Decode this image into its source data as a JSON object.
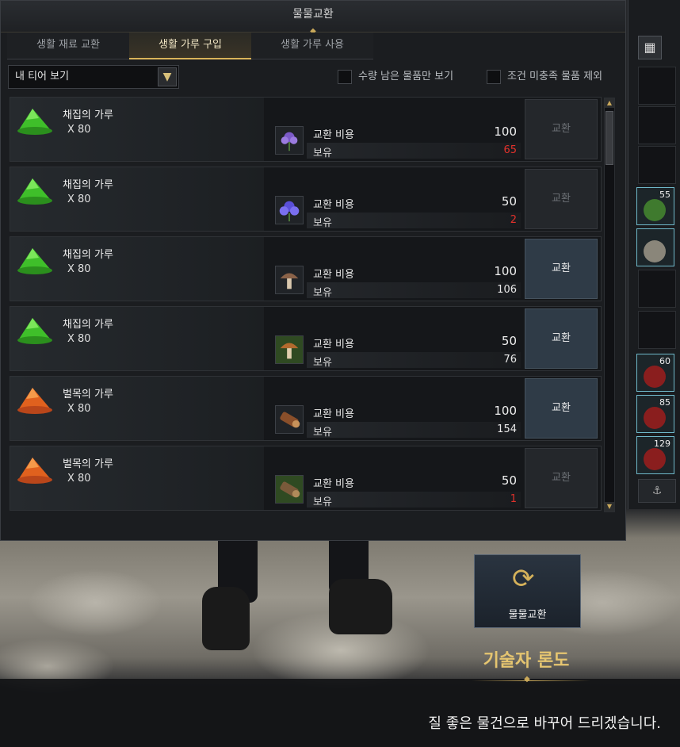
{
  "window": {
    "title": "물물교환"
  },
  "tabs": [
    {
      "label": "생활 재료 교환",
      "active": false
    },
    {
      "label": "생활 가루 구입",
      "active": true
    },
    {
      "label": "생활 가루 사용",
      "active": false
    }
  ],
  "filter": {
    "dropdown_value": "내 티어 보기",
    "checkbox_remaining": "수량 남은 물품만 보기",
    "checkbox_unmet": "조건 미충족 물품 제외"
  },
  "labels": {
    "cost": "교환 비용",
    "owned": "보유",
    "exchange": "교환"
  },
  "rows": [
    {
      "name": "채집의 가루",
      "qty": "X 80",
      "powder": "green",
      "cost_icon": "purple-flower-icon",
      "cost": "100",
      "owned": "65",
      "owned_low": true,
      "enabled": false
    },
    {
      "name": "채집의 가루",
      "qty": "X 80",
      "powder": "green",
      "cost_icon": "blue-flower-icon",
      "cost": "50",
      "owned": "2",
      "owned_low": true,
      "enabled": false
    },
    {
      "name": "채집의 가루",
      "qty": "X 80",
      "powder": "green",
      "cost_icon": "mushroom-icon",
      "cost": "100",
      "owned": "106",
      "owned_low": false,
      "enabled": true
    },
    {
      "name": "채집의 가루",
      "qty": "X 80",
      "powder": "green",
      "cost_icon": "mushroom-icon",
      "cost": "50",
      "owned": "76",
      "owned_low": false,
      "enabled": true
    },
    {
      "name": "벌목의 가루",
      "qty": "X 80",
      "powder": "orange",
      "cost_icon": "timber-icon",
      "cost": "100",
      "owned": "154",
      "owned_low": false,
      "enabled": true
    },
    {
      "name": "벌목의 가루",
      "qty": "X 80",
      "powder": "orange",
      "cost_icon": "timber-icon",
      "cost": "50",
      "owned": "1",
      "owned_low": true,
      "enabled": false
    }
  ],
  "inventory": {
    "slots": [
      {
        "count": "55",
        "icon": "herb-icon"
      },
      {
        "count": "",
        "icon": "ore-icon"
      },
      {
        "count": "60",
        "icon": "potion-icon"
      },
      {
        "count": "85",
        "icon": "potion-icon"
      },
      {
        "count": "129",
        "icon": "potion-icon"
      }
    ]
  },
  "trade_card": {
    "label": "물물교환"
  },
  "npc": {
    "name": "기술자 론도",
    "dialog": "질 좋은 물건으로 바꾸어 드리겠습니다."
  },
  "colors": {
    "accent_gold": "#d9b45a",
    "low_stock_red": "#e0312b",
    "enabled_button": "#2f3b47"
  }
}
